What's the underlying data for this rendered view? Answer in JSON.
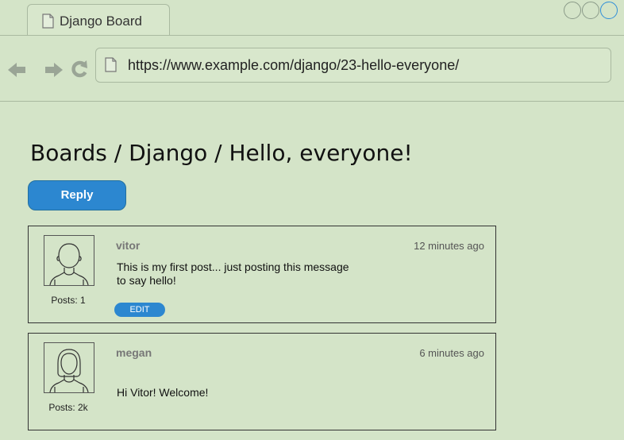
{
  "browser": {
    "tab_title": "Django Board",
    "url": "https://www.example.com/django/23-hello-everyone/",
    "accent_color": "#2f8ed8"
  },
  "page": {
    "breadcrumb": "Boards / Django / Hello, everyone!",
    "reply_label": "Reply"
  },
  "posts": [
    {
      "author": "vitor",
      "time": "12 minutes ago",
      "message": "This is my first post... just posting this message to say hello!",
      "posts_count": "Posts: 1",
      "edit_label": "EDIT",
      "avatar_icon": "user-male-icon"
    },
    {
      "author": "megan",
      "time": "6 minutes ago",
      "message": "Hi Vitor! Welcome!",
      "posts_count": "Posts: 2k",
      "avatar_icon": "user-female-icon"
    }
  ],
  "icons": {
    "tab": "document-icon",
    "back": "arrow-left-icon",
    "forward": "arrow-right-icon",
    "reload": "reload-icon",
    "address": "document-icon"
  },
  "colors": {
    "background": "#d4e4c8",
    "button": "#2c87d0",
    "border": "#333333"
  }
}
